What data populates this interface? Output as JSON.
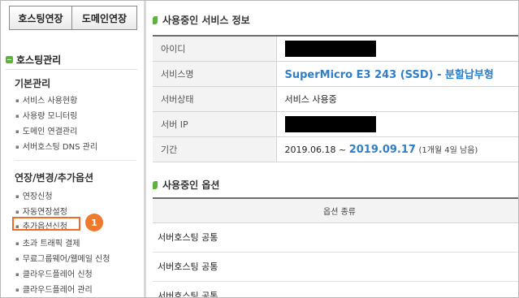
{
  "sidebar": {
    "buttons": {
      "hosting_renew": "호스팅연장",
      "domain_renew": "도메인연장"
    },
    "section_title": "호스팅관리",
    "groups": [
      {
        "title": "기본관리",
        "items": [
          "서비스 사용현황",
          "사용량 모니터링",
          "도메인 연결관리",
          "서버호스팅 DNS 관리"
        ]
      },
      {
        "title": "연장/변경/추가옵션",
        "items": [
          "연장신청",
          "자동연장설정",
          "추가옵션신청",
          "초과 트래픽 결제",
          "무료그룹웨어/웹메일 신청",
          "클라우드플레어 신청",
          "클라우드플레어 관리"
        ]
      }
    ],
    "step_badge": "1",
    "highlight_color": "#f06a28"
  },
  "main": {
    "info_title": "사용중인 서비스 정보",
    "info_rows": {
      "id_label": "아이디",
      "service_label": "서비스명",
      "service_value": "SuperMicro E3 243 (SSD) - 분할납부형",
      "status_label": "서버상태",
      "status_value": "서비스 사용중",
      "ip_label": "서버 IP",
      "period_label": "기간",
      "period_start": "2019.06.18 ~",
      "period_end": "2019.09.17",
      "period_note": "(1개월 4일 남음)"
    },
    "options_title": "사용중인 옵션",
    "options_header": "옵션 종류",
    "options_rows": [
      "서버호스팅 공통",
      "서버호스팅 공통",
      "서버호스팅 공통"
    ]
  },
  "colors": {
    "accent_blue": "#2f7ec7",
    "accent_green": "#5cb43c",
    "badge_orange": "#f07a2b"
  }
}
